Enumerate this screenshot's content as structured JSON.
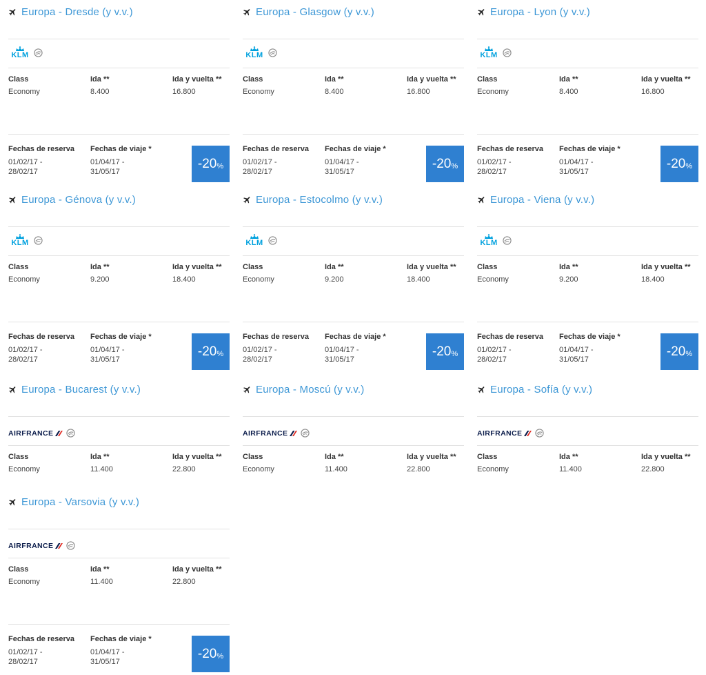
{
  "table_header": {
    "class": "Class",
    "ida": "Ida **",
    "ida_vuelta": "Ida y vuelta **"
  },
  "dates_header": {
    "reserva": "Fechas de reserva",
    "viaje": "Fechas de viaje *"
  },
  "logos": {
    "klm": "KLM",
    "airfrance": "AIRFRANCE"
  },
  "icons": {
    "destination": "plane-icon",
    "alliance": "skyteam-icon",
    "klm": "klm-crown-icon",
    "airfrance": "airfrance-stripe-icon"
  },
  "colors": {
    "accent": "#3d97d6",
    "badge": "#2f80d1",
    "klm": "#00a1de",
    "airfrance_navy": "#0b1c4b",
    "airfrance_red": "#e2261d"
  },
  "offers": [
    {
      "destination": "Europa - Dresde (y v.v.)",
      "airline": "klm",
      "class": "Economy",
      "ida": "8.400",
      "ida_vuelta": "16.800",
      "reserva_start": "01/02/17 -",
      "reserva_end": "28/02/17",
      "viaje_start": "01/04/17 -",
      "viaje_end": "31/05/17",
      "discount": "-20",
      "discount_unit": "%"
    },
    {
      "destination": "Europa - Glasgow (y v.v.)",
      "airline": "klm",
      "class": "Economy",
      "ida": "8.400",
      "ida_vuelta": "16.800",
      "reserva_start": "01/02/17 -",
      "reserva_end": "28/02/17",
      "viaje_start": "01/04/17 -",
      "viaje_end": "31/05/17",
      "discount": "-20",
      "discount_unit": "%"
    },
    {
      "destination": "Europa - Lyon (y v.v.)",
      "airline": "klm",
      "class": "Economy",
      "ida": "8.400",
      "ida_vuelta": "16.800",
      "reserva_start": "01/02/17 -",
      "reserva_end": "28/02/17",
      "viaje_start": "01/04/17 -",
      "viaje_end": "31/05/17",
      "discount": "-20",
      "discount_unit": "%"
    },
    {
      "destination": "Europa - Génova (y v.v.)",
      "airline": "klm",
      "class": "Economy",
      "ida": "9.200",
      "ida_vuelta": "18.400",
      "reserva_start": "01/02/17 -",
      "reserva_end": "28/02/17",
      "viaje_start": "01/04/17 -",
      "viaje_end": "31/05/17",
      "discount": "-20",
      "discount_unit": "%"
    },
    {
      "destination": "Europa - Estocolmo (y v.v.)",
      "airline": "klm",
      "class": "Economy",
      "ida": "9.200",
      "ida_vuelta": "18.400",
      "reserva_start": "01/02/17 -",
      "reserva_end": "28/02/17",
      "viaje_start": "01/04/17 -",
      "viaje_end": "31/05/17",
      "discount": "-20",
      "discount_unit": "%"
    },
    {
      "destination": "Europa - Viena (y v.v.)",
      "airline": "klm",
      "class": "Economy",
      "ida": "9.200",
      "ida_vuelta": "18.400",
      "reserva_start": "01/02/17 -",
      "reserva_end": "28/02/17",
      "viaje_start": "01/04/17 -",
      "viaje_end": "31/05/17",
      "discount": "-20",
      "discount_unit": "%"
    },
    {
      "destination": "Europa - Bucarest (y v.v.)",
      "airline": "airfrance",
      "class": "Economy",
      "ida": "11.400",
      "ida_vuelta": "22.800"
    },
    {
      "destination": "Europa - Moscú (y v.v.)",
      "airline": "airfrance",
      "class": "Economy",
      "ida": "11.400",
      "ida_vuelta": "22.800"
    },
    {
      "destination": "Europa - Sofía (y v.v.)",
      "airline": "airfrance",
      "class": "Economy",
      "ida": "11.400",
      "ida_vuelta": "22.800"
    },
    {
      "destination": "Europa - Varsovia (y v.v.)",
      "airline": "airfrance",
      "class": "Economy",
      "ida": "11.400",
      "ida_vuelta": "22.800",
      "reserva_start": "01/02/17 -",
      "reserva_end": "28/02/17",
      "viaje_start": "01/04/17 -",
      "viaje_end": "31/05/17",
      "discount": "-20",
      "discount_unit": "%"
    }
  ]
}
